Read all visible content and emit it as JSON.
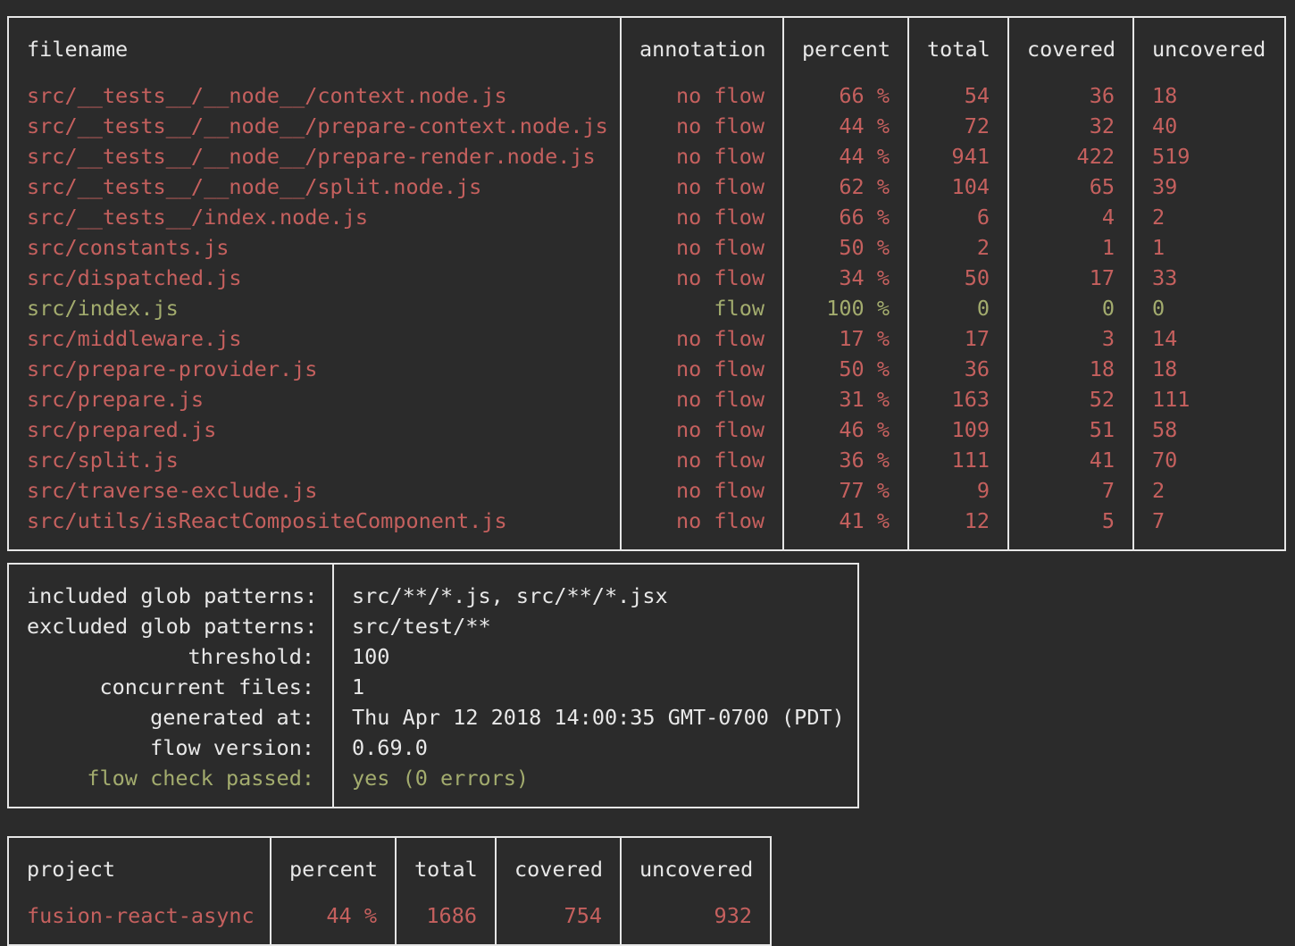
{
  "colors": {
    "background": "#2b2b2b",
    "text": "#e8e8e8",
    "uncovered_red": "#c5605e",
    "covered_green": "#a3ac6e",
    "border": "#e6e6e6"
  },
  "files_table": {
    "headers": {
      "filename": "filename",
      "annotation": "annotation",
      "percent": "percent",
      "total": "total",
      "covered": "covered",
      "uncovered": "uncovered"
    },
    "rows": [
      {
        "filename": "src/__tests__/__node__/context.node.js",
        "annotation": "no flow",
        "percent": "66 %",
        "total": "54",
        "covered": "36",
        "uncovered": "18",
        "status": "red"
      },
      {
        "filename": "src/__tests__/__node__/prepare-context.node.js",
        "annotation": "no flow",
        "percent": "44 %",
        "total": "72",
        "covered": "32",
        "uncovered": "40",
        "status": "red"
      },
      {
        "filename": "src/__tests__/__node__/prepare-render.node.js",
        "annotation": "no flow",
        "percent": "44 %",
        "total": "941",
        "covered": "422",
        "uncovered": "519",
        "status": "red"
      },
      {
        "filename": "src/__tests__/__node__/split.node.js",
        "annotation": "no flow",
        "percent": "62 %",
        "total": "104",
        "covered": "65",
        "uncovered": "39",
        "status": "red"
      },
      {
        "filename": "src/__tests__/index.node.js",
        "annotation": "no flow",
        "percent": "66 %",
        "total": "6",
        "covered": "4",
        "uncovered": "2",
        "status": "red"
      },
      {
        "filename": "src/constants.js",
        "annotation": "no flow",
        "percent": "50 %",
        "total": "2",
        "covered": "1",
        "uncovered": "1",
        "status": "red"
      },
      {
        "filename": "src/dispatched.js",
        "annotation": "no flow",
        "percent": "34 %",
        "total": "50",
        "covered": "17",
        "uncovered": "33",
        "status": "red"
      },
      {
        "filename": "src/index.js",
        "annotation": "flow",
        "percent": "100 %",
        "total": "0",
        "covered": "0",
        "uncovered": "0",
        "status": "green"
      },
      {
        "filename": "src/middleware.js",
        "annotation": "no flow",
        "percent": "17 %",
        "total": "17",
        "covered": "3",
        "uncovered": "14",
        "status": "red"
      },
      {
        "filename": "src/prepare-provider.js",
        "annotation": "no flow",
        "percent": "50 %",
        "total": "36",
        "covered": "18",
        "uncovered": "18",
        "status": "red"
      },
      {
        "filename": "src/prepare.js",
        "annotation": "no flow",
        "percent": "31 %",
        "total": "163",
        "covered": "52",
        "uncovered": "111",
        "status": "red"
      },
      {
        "filename": "src/prepared.js",
        "annotation": "no flow",
        "percent": "46 %",
        "total": "109",
        "covered": "51",
        "uncovered": "58",
        "status": "red"
      },
      {
        "filename": "src/split.js",
        "annotation": "no flow",
        "percent": "36 %",
        "total": "111",
        "covered": "41",
        "uncovered": "70",
        "status": "red"
      },
      {
        "filename": "src/traverse-exclude.js",
        "annotation": "no flow",
        "percent": "77 %",
        "total": "9",
        "covered": "7",
        "uncovered": "2",
        "status": "red"
      },
      {
        "filename": "src/utils/isReactCompositeComponent.js",
        "annotation": "no flow",
        "percent": "41 %",
        "total": "12",
        "covered": "5",
        "uncovered": "7",
        "status": "red"
      }
    ]
  },
  "config_table": {
    "rows": [
      {
        "label": "included glob patterns:",
        "value": "src/**/*.js, src/**/*.jsx",
        "status": "white"
      },
      {
        "label": "excluded glob patterns:",
        "value": "src/test/**",
        "status": "white"
      },
      {
        "label": "threshold:",
        "value": "100",
        "status": "white"
      },
      {
        "label": "concurrent files:",
        "value": "1",
        "status": "white"
      },
      {
        "label": "generated at:",
        "value": "Thu Apr 12 2018 14:00:35 GMT-0700 (PDT)",
        "status": "white"
      },
      {
        "label": "flow version:",
        "value": "0.69.0",
        "status": "white"
      },
      {
        "label": "flow check passed:",
        "value": "yes (0 errors)",
        "status": "green"
      }
    ]
  },
  "project_table": {
    "headers": {
      "project": "project",
      "percent": "percent",
      "total": "total",
      "covered": "covered",
      "uncovered": "uncovered"
    },
    "row": {
      "project": "fusion-react-async",
      "percent": "44 %",
      "total": "1686",
      "covered": "754",
      "uncovered": "932",
      "status": "red"
    }
  }
}
